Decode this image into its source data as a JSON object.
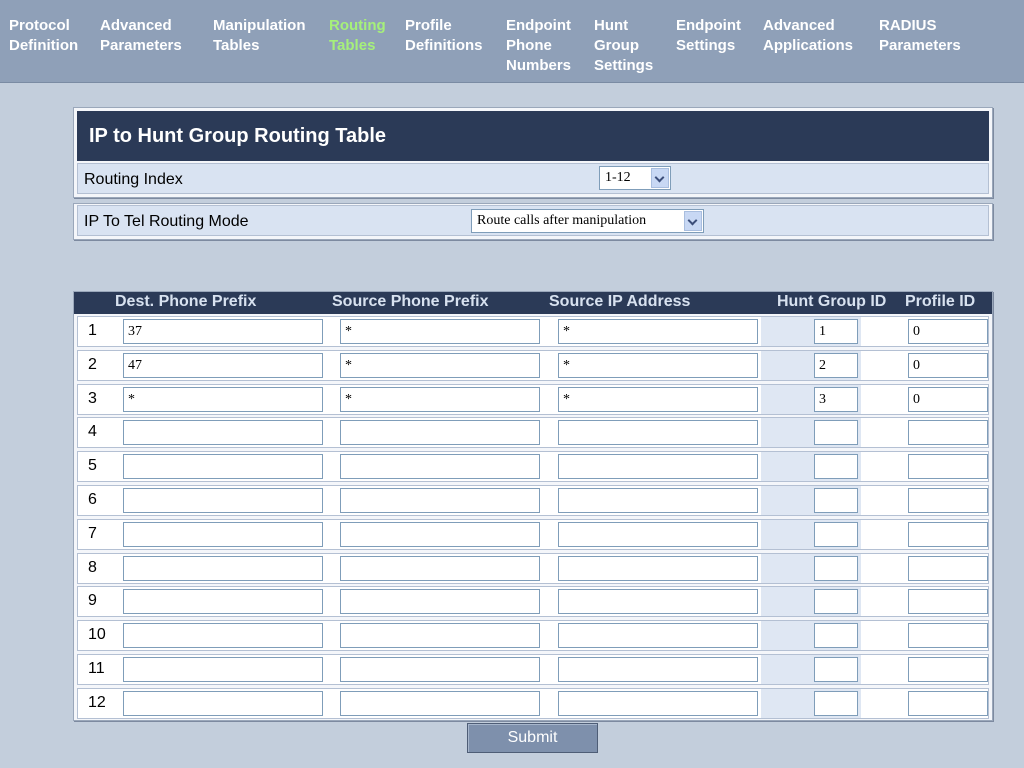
{
  "nav": {
    "items": [
      {
        "label": "Protocol\nDefinition"
      },
      {
        "label": "Advanced\nParameters"
      },
      {
        "label": "Manipulation\nTables"
      },
      {
        "label": "Routing\nTables"
      },
      {
        "label": "Profile\nDefinitions"
      },
      {
        "label": "Endpoint\nPhone\nNumbers"
      },
      {
        "label": "Hunt\nGroup\nSettings"
      },
      {
        "label": "Endpoint\nSettings"
      },
      {
        "label": "Advanced\nApplications"
      },
      {
        "label": "RADIUS\nParameters"
      }
    ],
    "active_color": "#a6f07a"
  },
  "panel": {
    "title": "IP to Hunt Group Routing Table",
    "routing_index": {
      "label": "Routing Index",
      "value": "1-12"
    },
    "routing_mode": {
      "label": "IP To Tel Routing Mode",
      "value": "Route calls after manipulation"
    }
  },
  "table": {
    "headers": [
      "Dest. Phone Prefix",
      "Source Phone Prefix",
      "Source IP Address",
      "Hunt Group ID",
      "Profile ID"
    ],
    "rows": [
      {
        "index": "1",
        "dest": "37",
        "src_phone": "*",
        "src_ip": "*",
        "hunt": "1",
        "profile": "0"
      },
      {
        "index": "2",
        "dest": "47",
        "src_phone": "*",
        "src_ip": "*",
        "hunt": "2",
        "profile": "0"
      },
      {
        "index": "3",
        "dest": "*",
        "src_phone": "*",
        "src_ip": "*",
        "hunt": "3",
        "profile": "0"
      },
      {
        "index": "4",
        "dest": "",
        "src_phone": "",
        "src_ip": "",
        "hunt": "",
        "profile": ""
      },
      {
        "index": "5",
        "dest": "",
        "src_phone": "",
        "src_ip": "",
        "hunt": "",
        "profile": ""
      },
      {
        "index": "6",
        "dest": "",
        "src_phone": "",
        "src_ip": "",
        "hunt": "",
        "profile": ""
      },
      {
        "index": "7",
        "dest": "",
        "src_phone": "",
        "src_ip": "",
        "hunt": "",
        "profile": ""
      },
      {
        "index": "8",
        "dest": "",
        "src_phone": "",
        "src_ip": "",
        "hunt": "",
        "profile": ""
      },
      {
        "index": "9",
        "dest": "",
        "src_phone": "",
        "src_ip": "",
        "hunt": "",
        "profile": ""
      },
      {
        "index": "10",
        "dest": "",
        "src_phone": "",
        "src_ip": "",
        "hunt": "",
        "profile": ""
      },
      {
        "index": "11",
        "dest": "",
        "src_phone": "",
        "src_ip": "",
        "hunt": "",
        "profile": ""
      },
      {
        "index": "12",
        "dest": "",
        "src_phone": "",
        "src_ip": "",
        "hunt": "",
        "profile": ""
      }
    ]
  },
  "submit_label": "Submit"
}
